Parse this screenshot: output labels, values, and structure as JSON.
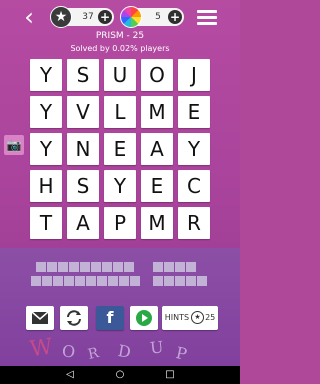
{
  "header": {
    "stars_count": "37",
    "colors_count": "5",
    "puzzle_title": "PRISM - 25",
    "solved_text": "Solved by 0.02% players"
  },
  "icons": {
    "back": "‹",
    "plus": "+",
    "star": "★",
    "camera": "📷"
  },
  "grid": {
    "rows": [
      [
        "Y",
        "S",
        "U",
        "O",
        "J"
      ],
      [
        "Y",
        "V",
        "L",
        "M",
        "E"
      ],
      [
        "Y",
        "N",
        "E",
        "A",
        "Y"
      ],
      [
        "H",
        "S",
        "Y",
        "E",
        "C"
      ],
      [
        "T",
        "A",
        "P",
        "M",
        "R"
      ]
    ]
  },
  "actions": {
    "facebook_label": "f",
    "hints_label": "HINTS",
    "hints_count": "25"
  },
  "branding": {
    "letters": [
      "W",
      "O",
      "R",
      "D",
      "U",
      "P"
    ]
  },
  "nav": {
    "back": "◁",
    "home": "○",
    "recents": "□"
  }
}
